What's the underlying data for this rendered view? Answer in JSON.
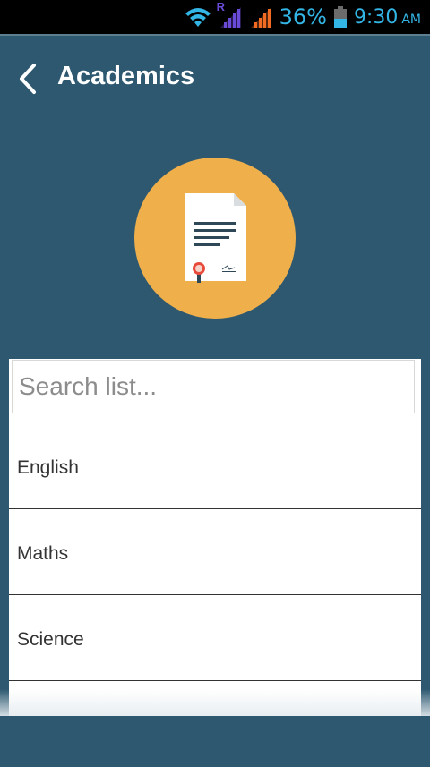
{
  "status_bar": {
    "signal_roaming_letter": "R",
    "battery_percent": "36%",
    "time": "9:30",
    "ampm": "AM",
    "accent_color": "#33b5e5"
  },
  "header": {
    "back_icon": "chevron-left-icon",
    "title": "Academics",
    "background_color": "#2d5870"
  },
  "hero": {
    "icon": "certificate-document-icon",
    "circle_color": "#efb04c"
  },
  "search": {
    "placeholder": "Search list...",
    "value": ""
  },
  "list": {
    "items": [
      {
        "label": "English"
      },
      {
        "label": "Maths"
      },
      {
        "label": "Science"
      },
      {
        "label": ""
      }
    ]
  }
}
